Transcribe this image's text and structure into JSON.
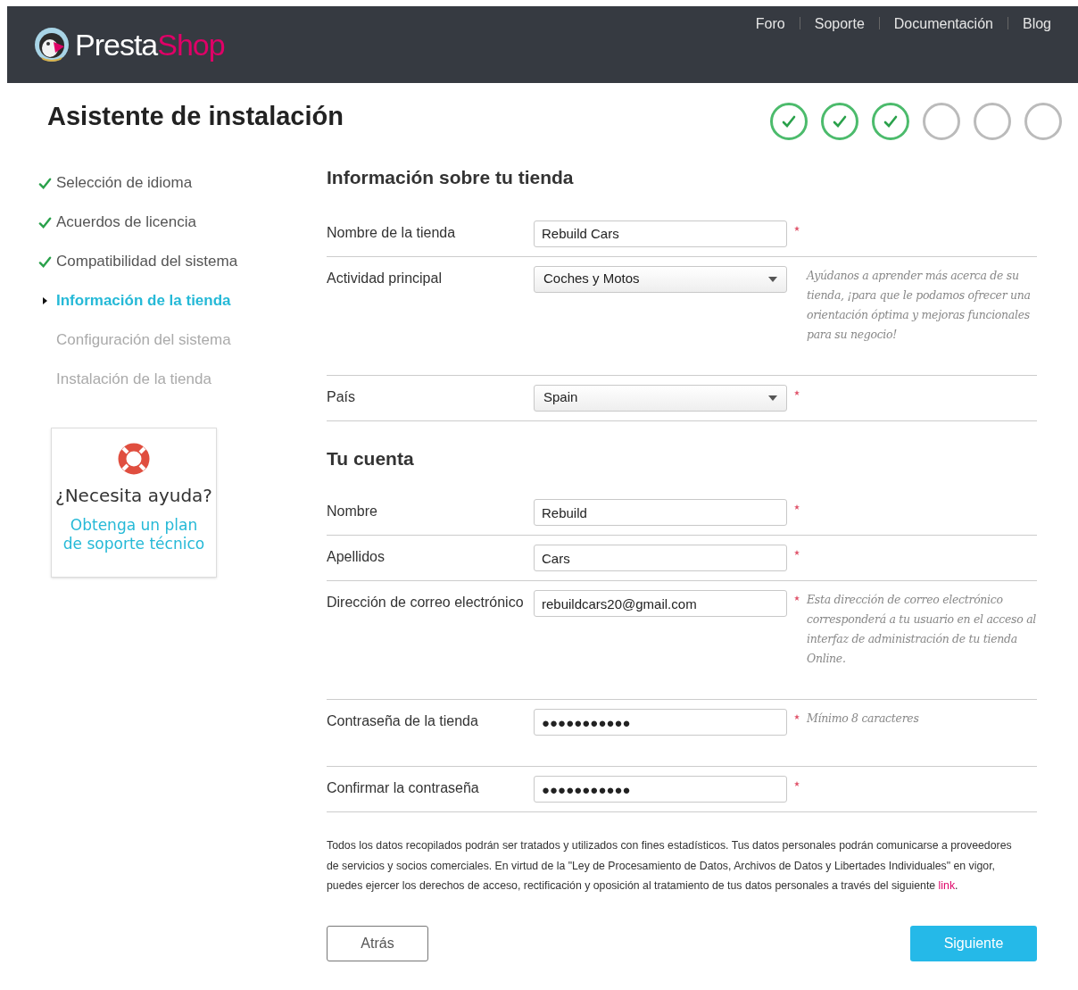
{
  "header": {
    "logo": {
      "first": "Presta",
      "second": "Shop"
    },
    "links": [
      "Foro",
      "Soporte",
      "Documentación",
      "Blog"
    ]
  },
  "title": "Asistente de instalación",
  "progress": [
    {
      "done": true
    },
    {
      "done": true
    },
    {
      "done": true
    },
    {
      "done": false
    },
    {
      "done": false
    },
    {
      "done": false
    }
  ],
  "steps": [
    {
      "label": "Selección de idioma",
      "done": true,
      "selected": false
    },
    {
      "label": "Acuerdos de licencia",
      "done": true,
      "selected": false
    },
    {
      "label": "Compatibilidad del sistema",
      "done": true,
      "selected": false
    },
    {
      "label": "Información de la tienda",
      "done": false,
      "selected": true
    },
    {
      "label": "Configuración del sistema",
      "done": false,
      "selected": false
    },
    {
      "label": "Instalación de la tienda",
      "done": false,
      "selected": false
    }
  ],
  "help_box": {
    "title": "¿Necesita ayuda?",
    "link": "Obtenga un plan de soporte técnico"
  },
  "sections": [
    {
      "title": "Información sobre tu tienda",
      "rows": [
        {
          "label": "Nombre de la tienda",
          "kind": "text",
          "value": "Rebuild Cars",
          "required": true
        },
        {
          "label": "Actividad principal",
          "kind": "select",
          "value": "Coches y Motos",
          "required": false,
          "help": "Ayúdanos a aprender más acerca de su tienda, ¡para que le podamos ofrecer una orientación óptima y mejoras funcionales para su negocio!"
        },
        {
          "label": "País",
          "kind": "select",
          "value": "Spain",
          "required": true
        }
      ]
    },
    {
      "title": "Tu cuenta",
      "rows": [
        {
          "label": "Nombre",
          "kind": "text",
          "value": "Rebuild",
          "required": true
        },
        {
          "label": "Apellidos",
          "kind": "text",
          "value": "Cars",
          "required": true
        },
        {
          "label": "Dirección de correo electrónico",
          "kind": "text",
          "value": "rebuildcars20@gmail.com",
          "required": true,
          "help": "Esta dirección de correo electrónico corresponderá a tu usuario en el acceso al interfaz de administración de tu tienda Online."
        },
        {
          "label": "Contraseña de la tienda",
          "kind": "password",
          "value": "●●●●●●●●●●●",
          "required": true,
          "help": "Mínimo 8 caracteres"
        },
        {
          "label": "Confirmar la contraseña",
          "kind": "password",
          "value": "●●●●●●●●●●●",
          "required": true
        }
      ]
    }
  ],
  "notice": {
    "text": "Todos los datos recopilados podrán ser tratados y utilizados con fines estadísticos. Tus datos personales podrán comunicarse a proveedores de servicios y socios comerciales. En virtud de la \"Ley de Procesamiento de Datos, Archivos de Datos y Libertades Individuales\" en vigor, puedes ejercer los derechos de acceso, rectificación y oposición al tratamiento de tus datos personales a través del siguiente",
    "link": "link",
    "end": "."
  },
  "buttons": {
    "back": "Atrás",
    "next": "Siguiente"
  }
}
